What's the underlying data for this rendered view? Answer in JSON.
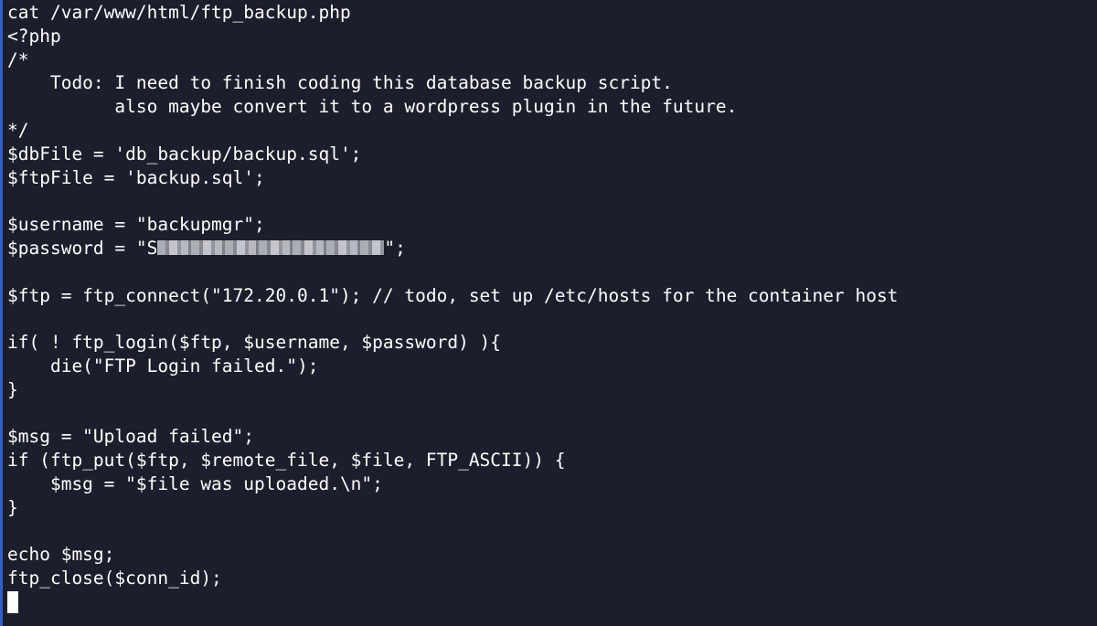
{
  "terminal": {
    "lines": [
      "cat /var/www/html/ftp_backup.php",
      "<?php",
      "/*",
      "    Todo: I need to finish coding this database backup script.",
      "          also maybe convert it to a wordpress plugin in the future.",
      "*/",
      "$dbFile = 'db_backup/backup.sql';",
      "$ftpFile = 'backup.sql';",
      "",
      "$username = \"backupmgr\";",
      "",
      "",
      "$ftp = ftp_connect(\"172.20.0.1\"); // todo, set up /etc/hosts for the container host",
      "",
      "if( ! ftp_login($ftp, $username, $password) ){",
      "    die(\"FTP Login failed.\");",
      "}",
      "",
      "$msg = \"Upload failed\";",
      "if (ftp_put($ftp, $remote_file, $file, FTP_ASCII)) {",
      "    $msg = \"$file was uploaded.\\n\";",
      "}",
      "",
      "echo $msg;",
      "ftp_close($conn_id);"
    ],
    "password_line": {
      "prefix": "$password = \"S",
      "suffix": "\";"
    }
  }
}
